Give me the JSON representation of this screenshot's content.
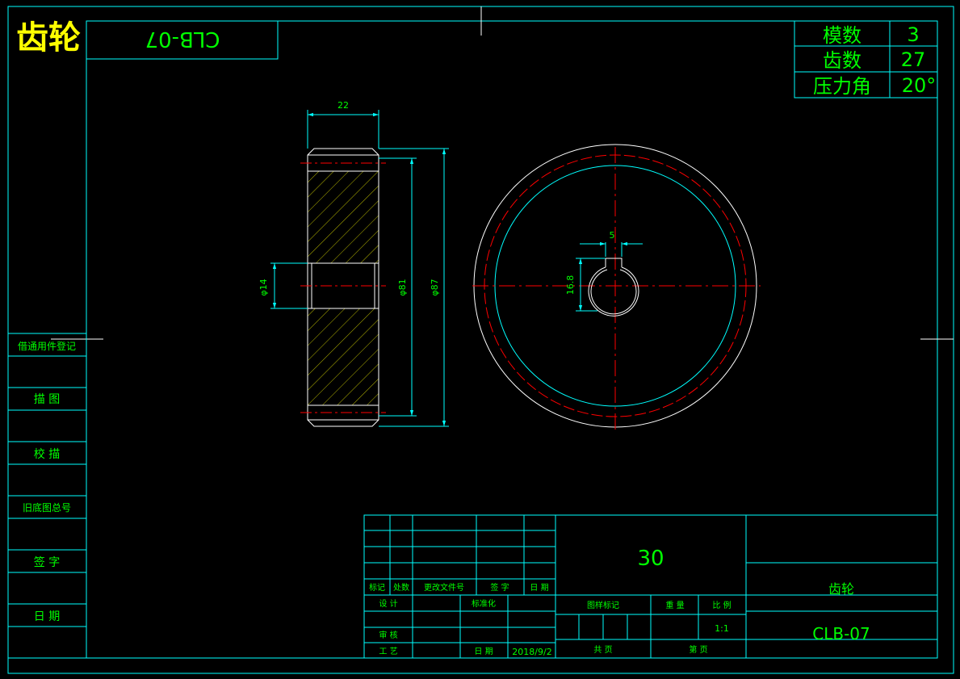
{
  "title": "齿轮",
  "code_box": "CLB-07",
  "params": [
    {
      "label": "模数",
      "value": "3"
    },
    {
      "label": "齿数",
      "value": "27"
    },
    {
      "label": "压力角",
      "value": "20°"
    }
  ],
  "dims": {
    "width": "22",
    "bore": "φ14",
    "root": "φ81",
    "outer": "φ87",
    "keyway_w": "5",
    "keyway_h": "16.8"
  },
  "left_strip": [
    "借通用件登记",
    "描 图",
    "校 描",
    "旧底图总号",
    "签 字",
    "日 期"
  ],
  "title_block": {
    "hdr_mark": "标记",
    "hdr_count": "处数",
    "hdr_doc": "更改文件号",
    "hdr_sign": "签 字",
    "hdr_date": "日 期",
    "design": "设 计",
    "standard": "标准化",
    "review": "审 核",
    "process": "工 艺",
    "date_label": "日 期",
    "date_value": "2018/9/2",
    "material": "30",
    "stage_label": "图样标记",
    "weight_label": "重 量",
    "scale_label": "比 例",
    "scale_value": "1:1",
    "total_label": "共 页",
    "sheet_label": "第 页",
    "part_name": "齿轮",
    "part_code": "CLB-07"
  }
}
